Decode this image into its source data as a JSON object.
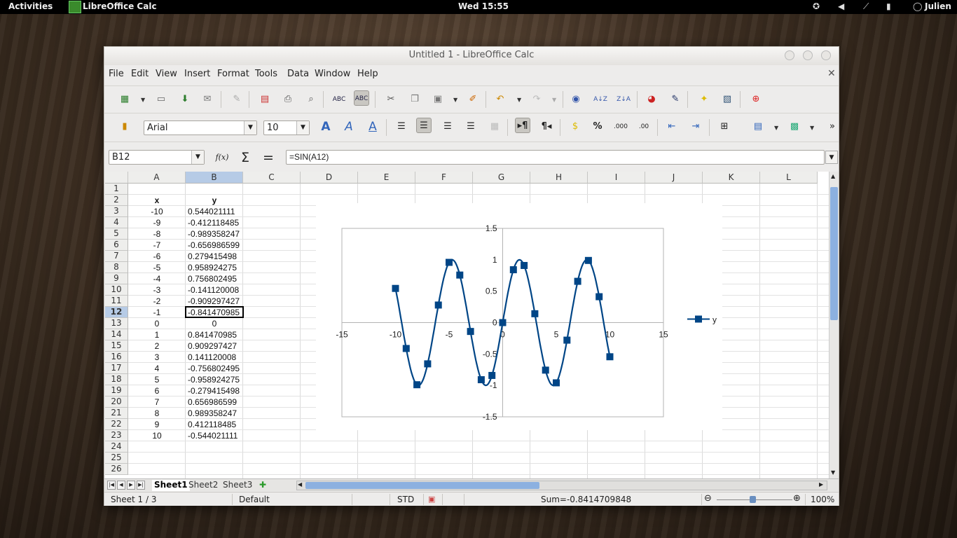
{
  "desktop": {
    "activities": "Activities",
    "app_name": "LibreOffice Calc",
    "clock": "Wed 15:55",
    "user": "Julien"
  },
  "window": {
    "title": "Untitled 1 - LibreOffice Calc"
  },
  "menu": [
    "File",
    "Edit",
    "View",
    "Insert",
    "Format",
    "Tools",
    "Data",
    "Window",
    "Help"
  ],
  "formatting": {
    "font_name": "Arial",
    "font_size": "10"
  },
  "formula_bar": {
    "name_box": "B12",
    "formula": "=SIN(A12)",
    "function_wizard": "f(x)",
    "sum_symbol": "Σ",
    "equals_symbol": "="
  },
  "columns": [
    "A",
    "B",
    "C",
    "D",
    "E",
    "F",
    "G",
    "H",
    "I",
    "J",
    "K",
    "L"
  ],
  "rows": [
    "1",
    "2",
    "3",
    "4",
    "5",
    "6",
    "7",
    "8",
    "9",
    "10",
    "11",
    "12",
    "13",
    "14",
    "15",
    "16",
    "17",
    "18",
    "19",
    "20",
    "21",
    "22",
    "23",
    "24",
    "25",
    "26"
  ],
  "selected_cell": {
    "column": "B",
    "row": "12"
  },
  "table": {
    "header_x": "x",
    "header_y": "y",
    "x": [
      "-10",
      "-9",
      "-8",
      "-7",
      "-6",
      "-5",
      "-4",
      "-3",
      "-2",
      "-1",
      "0",
      "1",
      "2",
      "3",
      "4",
      "5",
      "6",
      "7",
      "8",
      "9",
      "10"
    ],
    "y": [
      "0.544021111",
      "-0.412118485",
      "-0.989358247",
      "-0.656986599",
      "0.279415498",
      "0.958924275",
      "0.756802495",
      "-0.141120008",
      "-0.909297427",
      "-0.841470985",
      "0",
      "0.841470985",
      "0.909297427",
      "0.141120008",
      "-0.756802495",
      "-0.958924275",
      "-0.279415498",
      "0.656986599",
      "0.989358247",
      "0.412118485",
      "-0.544021111"
    ]
  },
  "chart_data": {
    "type": "scatter",
    "x": [
      -10,
      -9,
      -8,
      -7,
      -6,
      -5,
      -4,
      -3,
      -2,
      -1,
      0,
      1,
      2,
      3,
      4,
      5,
      6,
      7,
      8,
      9,
      10
    ],
    "series": [
      {
        "name": "y",
        "values": [
          0.544021111,
          -0.412118485,
          -0.989358247,
          -0.656986599,
          0.279415498,
          0.958924275,
          0.756802495,
          -0.141120008,
          -0.909297427,
          -0.841470985,
          0,
          0.841470985,
          0.909297427,
          0.141120008,
          -0.756802495,
          -0.958924275,
          -0.279415498,
          0.656986599,
          0.989358247,
          0.412118485,
          -0.544021111
        ]
      }
    ],
    "smooth_line": true,
    "marker": "square",
    "color": "#004586",
    "xlim": [
      -15,
      15
    ],
    "ylim": [
      -1.5,
      1.5
    ],
    "xticks": [
      "-15",
      "-10",
      "-5",
      "0",
      "5",
      "10",
      "15"
    ],
    "yticks": [
      "1.5",
      "1",
      "0.5",
      "0",
      "-0.5",
      "-1",
      "-1.5"
    ],
    "legend_position": "right",
    "grid": false,
    "title": "",
    "xlabel": "",
    "ylabel": ""
  },
  "sheet_tabs": [
    "Sheet1",
    "Sheet2",
    "Sheet3"
  ],
  "active_sheet": "Sheet1",
  "status": {
    "sheet": "Sheet 1 / 3",
    "page_style": "Default",
    "mode": "STD",
    "sum": "Sum=-0.8414709848",
    "zoom": "100%",
    "zoom_minus": "⊖",
    "zoom_plus": "⊕"
  }
}
